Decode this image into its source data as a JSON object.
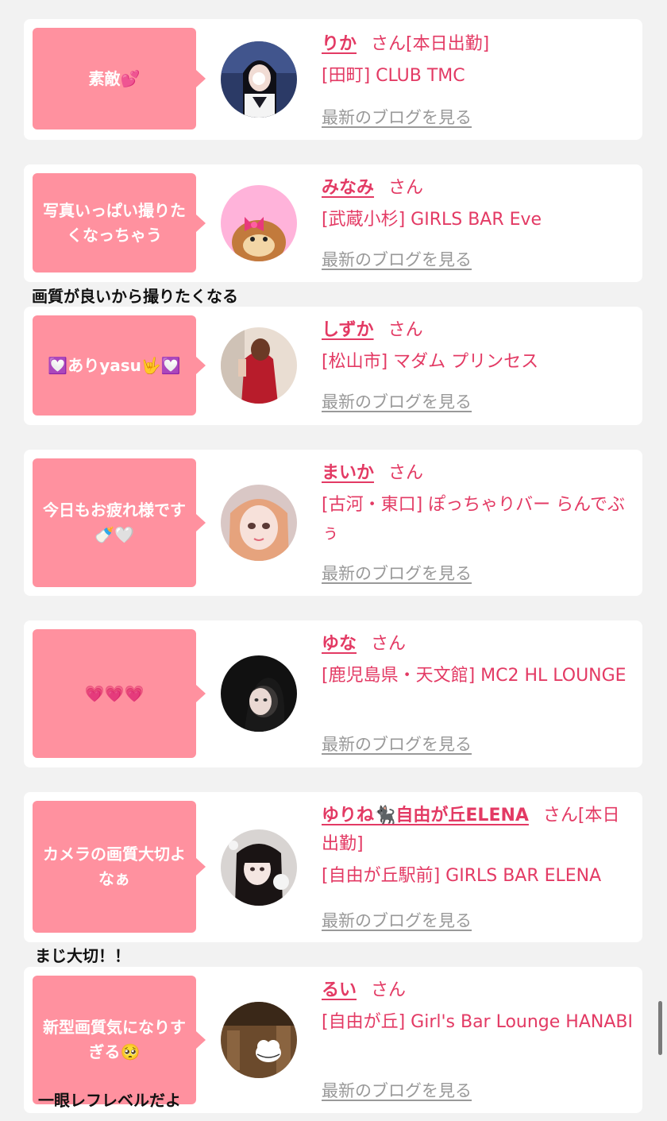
{
  "entries": [
    {
      "message": "素敵💕",
      "name": "りか",
      "suffix": "さん[本日出勤]",
      "shop": "[田町] CLUB TMC",
      "blog_link": "最新のブログを見る"
    },
    {
      "message": "写真いっぱい撮りたくなっちゃう",
      "name": "みなみ",
      "suffix": "さん",
      "shop": "[武蔵小杉] GIRLS BAR Eve",
      "blog_link": "最新のブログを見る"
    },
    {
      "message": "💟ありyasu🤟💟",
      "name": "しずか",
      "suffix": "さん",
      "shop": "[松山市] マダム プリンセス",
      "blog_link": "最新のブログを見る"
    },
    {
      "message": "今日もお疲れ様です🍼🤍",
      "name": "まいか",
      "suffix": "さん",
      "shop": "[古河・東口] ぽっちゃりバー らんでぶぅ",
      "blog_link": "最新のブログを見る"
    },
    {
      "message": "💗💗💗",
      "name": "ゆな",
      "suffix": "さん",
      "shop": "[鹿児島県・天文館] MC2 HL LOUNGE",
      "blog_link": "最新のブログを見る"
    },
    {
      "message": "カメラの画質大切よなぁ",
      "name": "ゆりね🐈‍⬛自由が丘ELENA",
      "suffix": "さん[本日出勤]",
      "shop": "[自由が丘駅前] GIRLS BAR ELENA",
      "blog_link": "最新のブログを見る"
    },
    {
      "message": "新型画質気になりすぎる🥺",
      "name": "るい",
      "suffix": "さん",
      "shop": "[自由が丘] Girl's Bar Lounge HANABI",
      "blog_link": "最新のブログを見る"
    }
  ],
  "captions": {
    "after_minami": "画質が良いから撮りたくなる",
    "after_yurine": "まじ大切！！",
    "bottom": "一眼レフレベルだよ"
  },
  "colors": {
    "background": "#f2f2f2",
    "card": "#ffffff",
    "bubble": "#ff919f",
    "name": "#e33a64",
    "blog_link": "#999999"
  }
}
